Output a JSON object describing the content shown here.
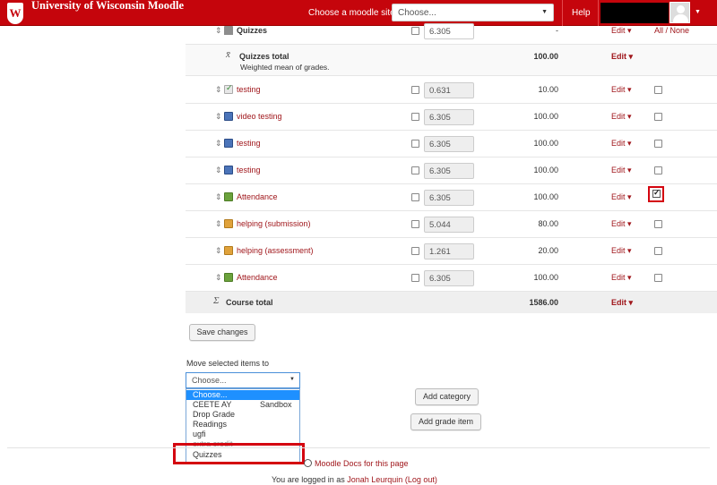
{
  "navbar": {
    "brand": "University of Wisconsin Moodle",
    "brand_glyph": "W",
    "site_label": "Choose a moodle site:",
    "site_select_value": "Choose...",
    "help": "Help"
  },
  "all_none": "All / None",
  "rows": {
    "quizzes_cat": {
      "name": "Quizzes",
      "weight": "6.305",
      "max": "-",
      "edit": "Edit"
    },
    "quizzes_total": {
      "name": "Quizzes total",
      "note": "Weighted mean of grades.",
      "max": "100.00",
      "edit": "Edit"
    },
    "r1": {
      "name": "testing",
      "weight": "0.631",
      "max": "10.00",
      "edit": "Edit"
    },
    "r2": {
      "name": "video testing",
      "weight": "6.305",
      "max": "100.00",
      "edit": "Edit"
    },
    "r3": {
      "name": "testing",
      "weight": "6.305",
      "max": "100.00",
      "edit": "Edit"
    },
    "r4": {
      "name": "testing",
      "weight": "6.305",
      "max": "100.00",
      "edit": "Edit"
    },
    "r5": {
      "name": "Attendance",
      "weight": "6.305",
      "max": "100.00",
      "edit": "Edit"
    },
    "r6": {
      "name": "helping (submission)",
      "weight": "5.044",
      "max": "80.00",
      "edit": "Edit"
    },
    "r7": {
      "name": "helping (assessment)",
      "weight": "1.261",
      "max": "20.00",
      "edit": "Edit"
    },
    "r8": {
      "name": "Attendance",
      "weight": "6.305",
      "max": "100.00",
      "edit": "Edit"
    },
    "course_total": {
      "name": "Course total",
      "max": "1586.00",
      "edit": "Edit"
    }
  },
  "save_changes": "Save changes",
  "move": {
    "label": "Move selected items to",
    "selected": "Choose...",
    "options": [
      "Choose...",
      "CEETE AY",
      "Drop Grade",
      "Readings",
      "ugfi",
      "extra credit",
      "Quizzes"
    ],
    "sandbox": "Sandbox"
  },
  "add_category": "Add category",
  "add_grade_item": "Add grade item",
  "footer": {
    "docs": "Moodle Docs for this page",
    "logged_prefix": "You are logged in as",
    "user": "Jonah Leurquin",
    "logout": "(Log out)"
  },
  "colors": {
    "brand_red": "#c5050c",
    "link_red": "#a0171c",
    "highlight": "#d40510",
    "dropdown_selected": "#1e90ff"
  }
}
